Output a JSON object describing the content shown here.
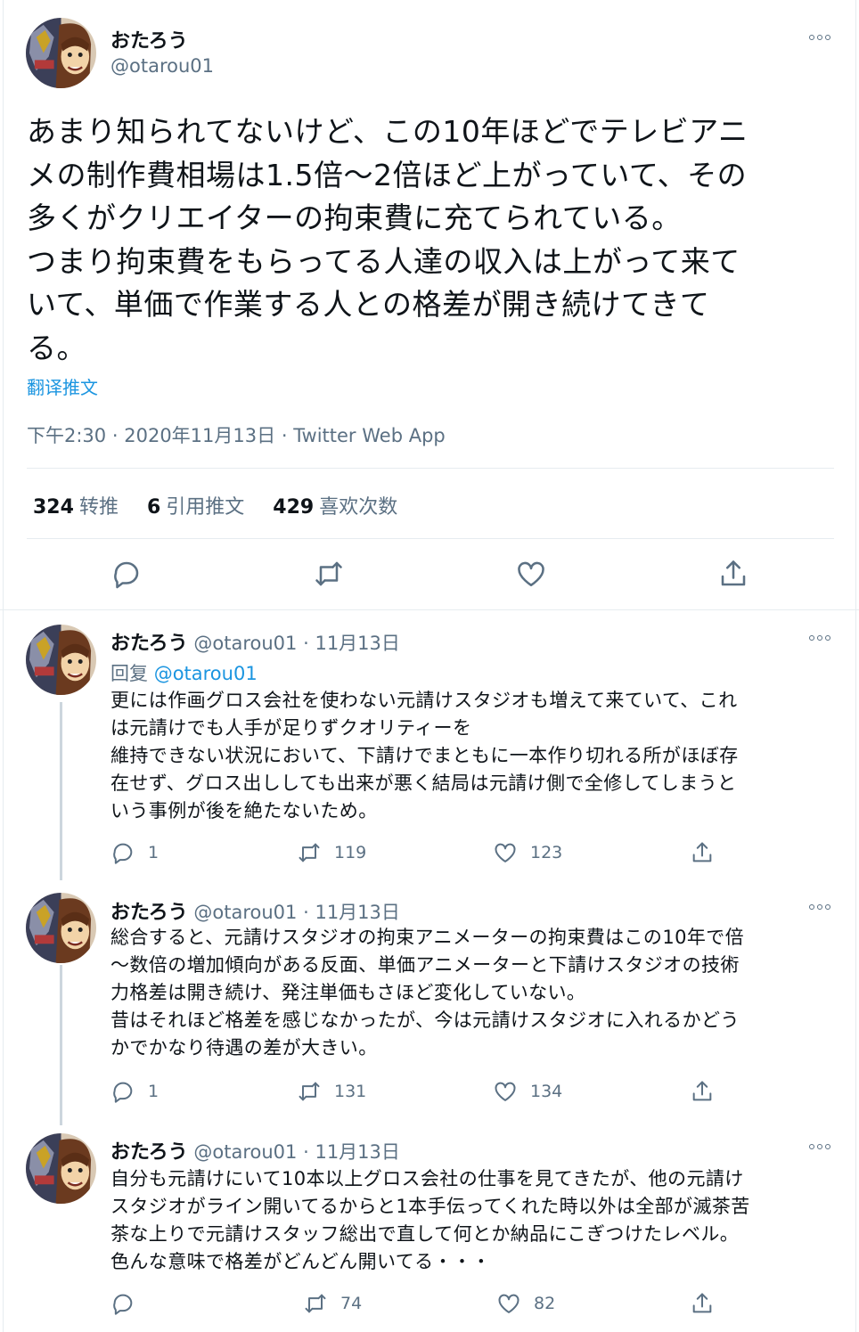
{
  "main_tweet": {
    "author_name": "おたろう",
    "author_handle": "@otarou01",
    "text_lines": [
      "あまり知られてないけど、この10年ほどでテレビアニ",
      "メの制作費相場は1.5倍〜2倍ほど上がっていて、その",
      "多くがクリエイターの拘束費に充てられている。",
      "つまり拘束費をもらってる人達の収入は上がって来て",
      "いて、単価で作業する人との格差が開き続けてきて",
      "る。"
    ],
    "translate_label": "翻译推文",
    "time": "下午2:30",
    "date": "2020年11月13日",
    "separator": "·",
    "source": "Twitter Web App",
    "stats": {
      "retweets_count": "324",
      "retweets_label": "转推",
      "quotes_count": "6",
      "quotes_label": "引用推文",
      "likes_count": "429",
      "likes_label": "喜欢次数"
    }
  },
  "replies": [
    {
      "author_name": "おたろう",
      "author_handle": "@otarou01",
      "separator": "·",
      "date": "11月13日",
      "reply_prefix": "回复",
      "reply_mention": "@otarou01",
      "text_lines": [
        "更には作画グロス会社を使わない元請けスタジオも増えて来ていて、これ",
        "は元請けでも人手が足りずクオリティーを",
        "維持できない状況において、下請けでまともに一本作り切れる所がほぼ存",
        "在せず、グロス出ししても出来が悪く結局は元請け側で全修してしまうと",
        "いう事例が後を絶たないため。"
      ],
      "reply_count": "1",
      "retweet_count": "119",
      "like_count": "123"
    },
    {
      "author_name": "おたろう",
      "author_handle": "@otarou01",
      "separator": "·",
      "date": "11月13日",
      "text_lines": [
        "総合すると、元請けスタジオの拘束アニメーターの拘束費はこの10年で倍",
        "〜数倍の増加傾向がある反面、単価アニメーターと下請けスタジオの技術",
        "力格差は開き続け、発注単価もさほど変化していない。",
        "昔はそれほど格差を感じなかったが、今は元請けスタジオに入れるかどう",
        "かでかなり待遇の差が大きい。"
      ],
      "reply_count": "1",
      "retweet_count": "131",
      "like_count": "134"
    },
    {
      "author_name": "おたろう",
      "author_handle": "@otarou01",
      "separator": "·",
      "date": "11月13日",
      "text_lines": [
        "自分も元請けにいて10本以上グロス会社の仕事を見てきたが、他の元請け",
        "スタジオがライン開いてるからと1本手伝ってくれた時以外は全部が滅茶苦",
        "茶な上りで元請けスタッフ総出で直して何とか納品にこぎつけたレベル。",
        "色んな意味で格差がどんどん開いてる・・・"
      ],
      "retweet_count": "74",
      "like_count": "82"
    }
  ],
  "colors": {
    "text": "#0f1419",
    "secondary": "#5b7083",
    "link": "#1b95e0",
    "border": "#e6ecf0",
    "thread_line": "#ccd6dd"
  },
  "icons": [
    "more-icon",
    "reply-icon",
    "retweet-icon",
    "like-icon",
    "share-icon"
  ]
}
